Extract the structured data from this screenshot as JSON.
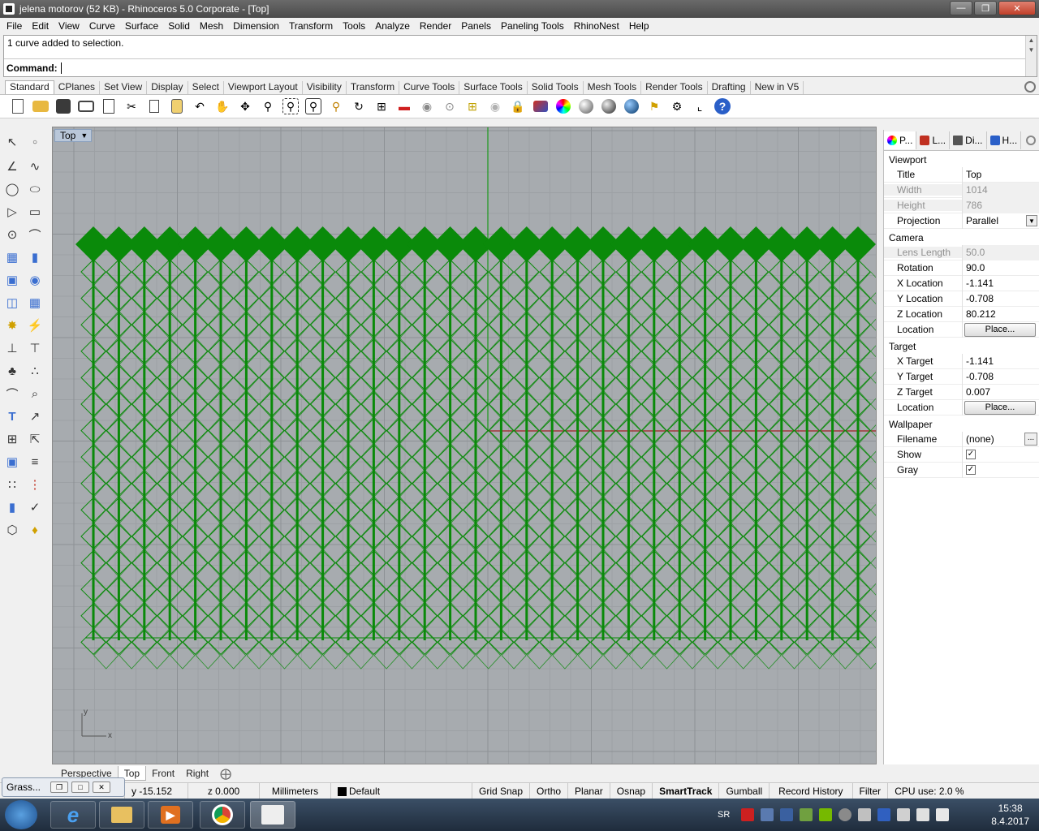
{
  "window": {
    "title": "jelena motorov (52 KB) - Rhinoceros  5.0 Corporate - [Top]"
  },
  "menu": [
    "File",
    "Edit",
    "View",
    "Curve",
    "Surface",
    "Solid",
    "Mesh",
    "Dimension",
    "Transform",
    "Tools",
    "Analyze",
    "Render",
    "Panels",
    "Paneling Tools",
    "RhinoNest",
    "Help"
  ],
  "command": {
    "history": "1 curve added to selection.",
    "prompt": "Command:"
  },
  "toolbar_tabs": [
    "Standard",
    "CPlanes",
    "Set View",
    "Display",
    "Select",
    "Viewport Layout",
    "Visibility",
    "Transform",
    "Curve Tools",
    "Surface Tools",
    "Solid Tools",
    "Mesh Tools",
    "Render Tools",
    "Drafting",
    "New in V5"
  ],
  "toolbar_icons": [
    "new-icon",
    "open-icon",
    "save-icon",
    "print-icon",
    "import-icon",
    "cut-icon",
    "copy-icon",
    "paste-icon",
    "undo-icon",
    "pan-icon",
    "rotate-view-icon",
    "zoom-icon",
    "zoom-window-icon",
    "zoom-extents-icon",
    "zoom-selected-icon",
    "rotate-icon",
    "four-views-icon",
    "car-icon",
    "camera-icon",
    "cplane-icon",
    "light-icon",
    "lock-icon",
    "material-icon",
    "color-wheel-icon",
    "shaded-sphere-icon",
    "rendered-sphere-icon",
    "blue-sphere-icon",
    "properties-icon",
    "options-gear-icon",
    "osnap-icon",
    "help-icon"
  ],
  "viewport": {
    "title": "Top",
    "axis_x": "x",
    "axis_y": "y",
    "background": "#a7abaf",
    "pattern_color": "#0a8a0a"
  },
  "viewport_tabs": [
    "Perspective",
    "Top",
    "Front",
    "Right"
  ],
  "panel": {
    "tabs": [
      "P...",
      "L...",
      "Di...",
      "H..."
    ],
    "viewport_section": "Viewport",
    "viewport_rows": [
      {
        "key": "Title",
        "value": "Top"
      },
      {
        "key": "Width",
        "value": "1014"
      },
      {
        "key": "Height",
        "value": "786"
      },
      {
        "key": "Projection",
        "value": "Parallel"
      }
    ],
    "camera_section": "Camera",
    "camera_rows": [
      {
        "key": "Lens Length",
        "value": "50.0"
      },
      {
        "key": "Rotation",
        "value": "90.0"
      },
      {
        "key": "X Location",
        "value": "-1.141"
      },
      {
        "key": "Y Location",
        "value": "-0.708"
      },
      {
        "key": "Z Location",
        "value": "80.212"
      },
      {
        "key": "Location",
        "value": "Place..."
      }
    ],
    "target_section": "Target",
    "target_rows": [
      {
        "key": "X Target",
        "value": "-1.141"
      },
      {
        "key": "Y Target",
        "value": "-0.708"
      },
      {
        "key": "Z Target",
        "value": "0.007"
      },
      {
        "key": "Location",
        "value": "Place..."
      }
    ],
    "wallpaper_section": "Wallpaper",
    "wallpaper_rows": [
      {
        "key": "Filename",
        "value": "(none)"
      },
      {
        "key": "Show",
        "value": "✓"
      },
      {
        "key": "Gray",
        "value": "✓"
      }
    ]
  },
  "status": {
    "grass": "Grass...",
    "y": "y -15.152",
    "z": "z 0.000",
    "units": "Millimeters",
    "layer": "Default",
    "grid_snap": "Grid Snap",
    "ortho": "Ortho",
    "planar": "Planar",
    "osnap": "Osnap",
    "smarttrack": "SmartTrack",
    "gumball": "Gumball",
    "record_history": "Record History",
    "filter": "Filter",
    "cpu": "CPU use: 2.0 %"
  },
  "taskbar": {
    "lang": "SR",
    "time": "15:38",
    "date": "8.4.2017"
  }
}
